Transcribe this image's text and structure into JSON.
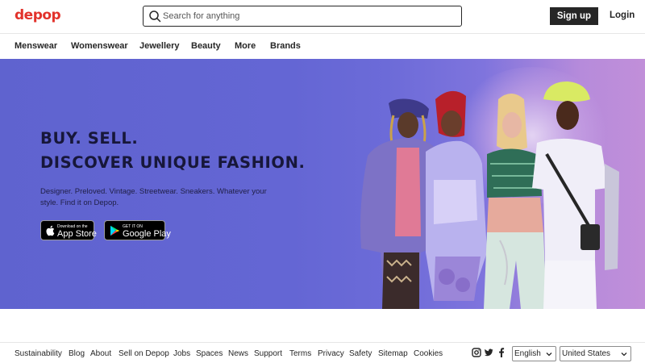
{
  "header": {
    "logo": "depop",
    "search_placeholder": "Search for anything",
    "signup_label": "Sign up",
    "login_label": "Login"
  },
  "nav": {
    "items": [
      "Menswear",
      "Womenswear",
      "Jewellery",
      "Beauty",
      "More",
      "Brands"
    ]
  },
  "hero": {
    "headline_line1": "BUY. SELL.",
    "headline_line2": "DISCOVER UNIQUE FASHION.",
    "subtext": "Designer. Preloved. Vintage. Streetwear. Sneakers. Whatever your style. Find it on Depop.",
    "app_store": {
      "small": "Download on the",
      "big": "App Store"
    },
    "google_play": {
      "small": "GET IT ON",
      "big": "Google Play"
    }
  },
  "footer": {
    "links": [
      "Sustainability",
      "Blog",
      "About",
      "Sell on Depop",
      "Jobs",
      "Spaces",
      "News",
      "Support",
      "Terms",
      "Privacy",
      "Safety",
      "Sitemap",
      "Cookies"
    ],
    "social_icons": [
      "instagram-icon",
      "twitter-icon",
      "facebook-icon"
    ],
    "language_selected": "English",
    "country_selected": "United States"
  },
  "colors": {
    "brand": "#e2322b",
    "dark": "#262626",
    "hero_bg": "#6466d4",
    "hero_text": "#17173a"
  }
}
